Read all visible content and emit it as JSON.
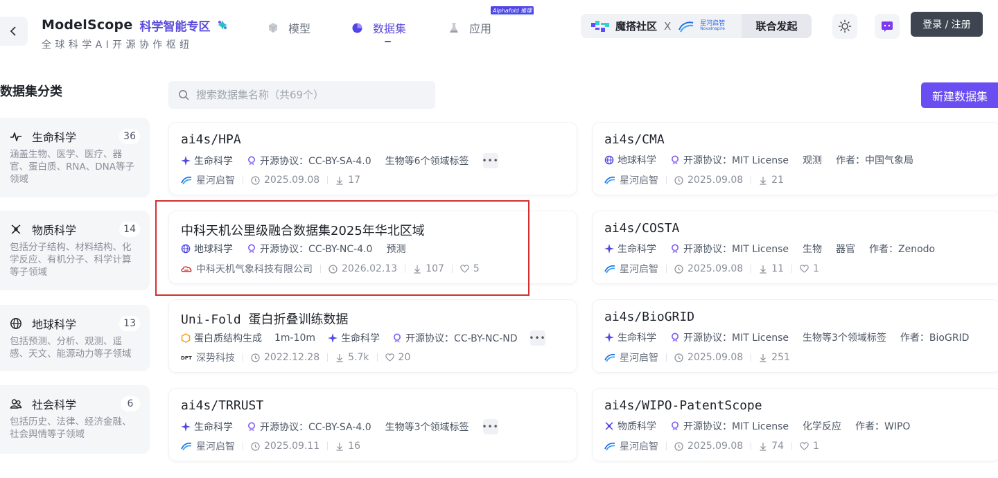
{
  "header": {
    "brand_name": "ModelScope",
    "brand_zone": "科学智能专区",
    "brand_sub": "全球科学AI开源协作枢纽",
    "nav": [
      {
        "label": "模型",
        "icon": "cube-icon",
        "active": false
      },
      {
        "label": "数据集",
        "icon": "dataset-icon",
        "active": true
      },
      {
        "label": "应用",
        "icon": "flask-icon",
        "active": false
      }
    ],
    "nav_badge": "Alphafold 推理",
    "collab_brand": "魔搭社区",
    "collab_x": "X",
    "collab_partner_cn": "星河启智",
    "collab_partner_en": "NovaInspire",
    "collab_action": "联合发起",
    "login_label": "登录 / 注册"
  },
  "sidebar": {
    "title": "数据集分类",
    "categories": [
      {
        "name": "生命科学",
        "count": "36",
        "desc": "涵盖生物、医学、医疗、器官、蛋白质、RNA、DNA等子领域",
        "icon": "life-science-icon"
      },
      {
        "name": "物质科学",
        "count": "14",
        "desc": "包括分子结构、材料结构、化学反应、有机分子、科学计算等子领域",
        "icon": "matter-science-icon"
      },
      {
        "name": "地球科学",
        "count": "13",
        "desc": "包括预测、分析、观测、遥感、天文、能源动力等子领域",
        "icon": "globe-icon"
      },
      {
        "name": "社会科学",
        "count": "6",
        "desc": "包括历史、法律、经济金融、社会舆情等子领域",
        "icon": "people-icon"
      }
    ]
  },
  "search": {
    "placeholder": "搜索数据集名称（共69个）"
  },
  "new_dataset_label": "新建数据集",
  "cards": [
    {
      "title": "ai4s/HPA",
      "tags": [
        "生命科学",
        "开源协议：CC-BY-SA-4.0",
        "生物等6个领域标签"
      ],
      "org": "星河启智",
      "date": "2025.09.08",
      "downloads": "17",
      "likes": ""
    },
    {
      "title": "ai4s/CMA",
      "tags": [
        "地球科学",
        "开源协议：MIT License",
        "观测",
        "作者：中国气象局"
      ],
      "org": "星河启智",
      "date": "2025.09.08",
      "downloads": "21",
      "likes": ""
    },
    {
      "title": "中科天机公里级融合数据集2025年华北区域",
      "tags": [
        "地球科学",
        "开源协议：CC-BY-NC-4.0",
        "预测"
      ],
      "org": "中科天机气象科技有限公司",
      "date": "2026.02.13",
      "downloads": "107",
      "likes": "5"
    },
    {
      "title": "ai4s/COSTA",
      "tags": [
        "生命科学",
        "开源协议：MIT License",
        "生物",
        "器官",
        "作者：Zenodo"
      ],
      "org": "星河启智",
      "date": "2025.09.08",
      "downloads": "11",
      "likes": "1"
    },
    {
      "title": "Uni-Fold 蛋白折叠训练数据",
      "tags": [
        "蛋白质结构生成",
        "1m-10m",
        "生命科学",
        "开源协议：CC-BY-NC-ND"
      ],
      "org": "深势科技",
      "date": "2022.12.28",
      "downloads": "5.7k",
      "likes": "20"
    },
    {
      "title": "ai4s/BioGRID",
      "tags": [
        "生命科学",
        "开源协议：MIT License",
        "生物等3个领域标签",
        "作者：BioGRID"
      ],
      "org": "星河启智",
      "date": "2025.09.08",
      "downloads": "251",
      "likes": ""
    },
    {
      "title": "ai4s/TRRUST",
      "tags": [
        "生命科学",
        "开源协议：CC-BY-SA-4.0",
        "生物等3个领域标签"
      ],
      "org": "星河启智",
      "date": "2025.09.11",
      "downloads": "16",
      "likes": ""
    },
    {
      "title": "ai4s/WIPO-PatentScope",
      "tags": [
        "物质科学",
        "开源协议：MIT License",
        "化学反应",
        "作者：WIPO"
      ],
      "org": "星河启智",
      "date": "2025.09.08",
      "downloads": "74",
      "likes": "1"
    }
  ],
  "colors": {
    "accent": "#5b4bdb",
    "button_primary": "#6b4ef2",
    "highlight_box": "#d32f2f",
    "login_bg": "#3f4550"
  }
}
